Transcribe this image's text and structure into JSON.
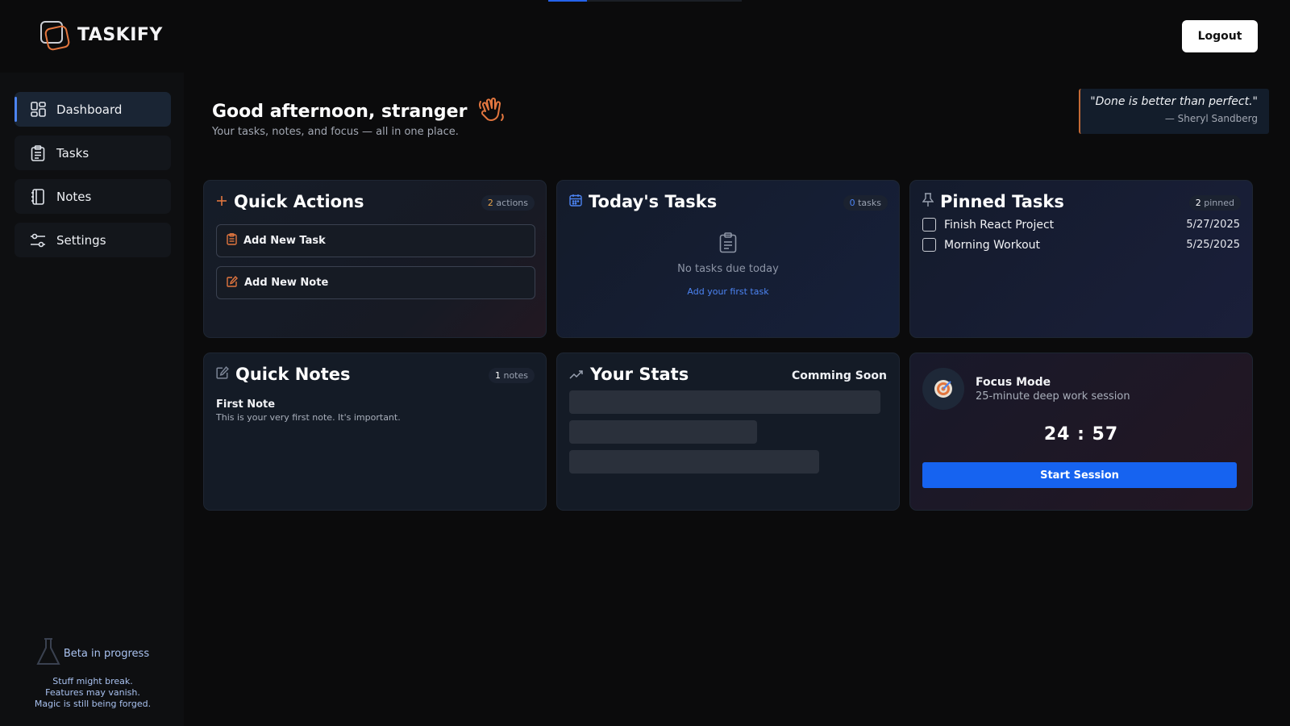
{
  "app": {
    "name": "TASKIFY"
  },
  "header": {
    "logout_label": "Logout",
    "load_progress_pct": 20
  },
  "sidebar": {
    "items": [
      {
        "label": "Dashboard",
        "icon": "dashboard-grid-icon",
        "active": true
      },
      {
        "label": "Tasks",
        "icon": "clipboard-list-icon",
        "active": false
      },
      {
        "label": "Notes",
        "icon": "notebook-icon",
        "active": false
      },
      {
        "label": "Settings",
        "icon": "sliders-icon",
        "active": false
      }
    ],
    "beta": {
      "title": "Beta in progress",
      "line1": "Stuff might break.",
      "line2": "Features may vanish.",
      "line3": "Magic is still being forged."
    }
  },
  "main": {
    "greeting": "Good afternoon, stranger",
    "subtitle": "Your tasks, notes, and focus — all in one place.",
    "quote": {
      "text": "\"Done is better than perfect.\"",
      "author": "— Sheryl Sandberg"
    }
  },
  "quick_actions": {
    "title": "Quick Actions",
    "count": "2",
    "count_label": "actions",
    "add_task": "Add New Task",
    "add_note": "Add New Note"
  },
  "todays_tasks": {
    "title": "Today's Tasks",
    "count": "0",
    "count_label": "tasks",
    "empty_text": "No tasks due today",
    "empty_link": "Add your first task"
  },
  "pinned_tasks": {
    "title": "Pinned Tasks",
    "count": "2",
    "count_label": "pinned",
    "items": [
      {
        "label": "Finish React Project",
        "date": "5/27/2025"
      },
      {
        "label": "Morning Workout",
        "date": "5/25/2025"
      }
    ]
  },
  "quick_notes": {
    "title": "Quick Notes",
    "count": "1",
    "count_label": "notes",
    "note_title": "First Note",
    "note_body": "This is your very first note. It's important."
  },
  "stats": {
    "title": "Your Stats",
    "status": "Comming Soon"
  },
  "focus": {
    "title": "Focus Mode",
    "subtitle": "25-minute deep work session",
    "timer": "24 : 57",
    "start_label": "Start Session"
  },
  "colors": {
    "accent": "#1663f0",
    "orange": "#e2763f",
    "background": "#0b0b0c"
  }
}
